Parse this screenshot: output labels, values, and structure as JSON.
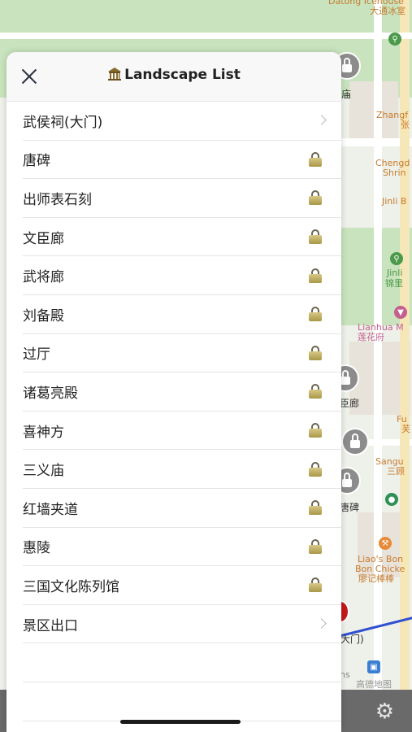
{
  "header": {
    "title": "Landscape List",
    "title_icon": "temple-icon",
    "close_icon": "close-icon"
  },
  "items": [
    {
      "label": "武侯祠(大门)",
      "accessory": "chevron"
    },
    {
      "label": "唐碑",
      "accessory": "lock"
    },
    {
      "label": "出师表石刻",
      "accessory": "lock"
    },
    {
      "label": "文臣廊",
      "accessory": "lock"
    },
    {
      "label": "武将廊",
      "accessory": "lock"
    },
    {
      "label": "刘备殿",
      "accessory": "lock"
    },
    {
      "label": "过厅",
      "accessory": "lock"
    },
    {
      "label": "诸葛亮殿",
      "accessory": "lock"
    },
    {
      "label": "喜神方",
      "accessory": "lock"
    },
    {
      "label": "三义庙",
      "accessory": "lock"
    },
    {
      "label": "红墙夹道",
      "accessory": "lock"
    },
    {
      "label": "惠陵",
      "accessory": "lock"
    },
    {
      "label": "三国文化陈列馆",
      "accessory": "lock"
    },
    {
      "label": "景区出口",
      "accessory": "chevron"
    }
  ],
  "map_labels": {
    "datong_en": "Datong Icehouse",
    "datong_cn": "大通冰室",
    "miao": "庙",
    "zhangfei_en": "Zhangf",
    "zhangfei_cn": "张",
    "chengdu_en": "Chengd",
    "shrine": "Shrin",
    "jinli_b": "Jinli B",
    "jinli": "Jinli",
    "jinli_cn": "锦里",
    "lianhua_en": "Lianhua M",
    "lianhua_cn": "莲花府",
    "chenlang": "臣廊",
    "fu": "Fu",
    "fu_cn": "芙",
    "sangu": "Sangu",
    "sangu_cn": "三顾",
    "tangbei": "唐碑",
    "liaos": "Liao's Bon",
    "chicken": "Bon Chicke",
    "liao_cn": "廖记棒棒",
    "damen": "大门)",
    "ns": "ns",
    "gaode": "高德地图"
  },
  "colors": {
    "accent_lock": "#c2b165",
    "route": "#3050d0",
    "map_green": "#c8e3bd"
  },
  "bottom": {
    "settings_icon": "gear-icon"
  }
}
